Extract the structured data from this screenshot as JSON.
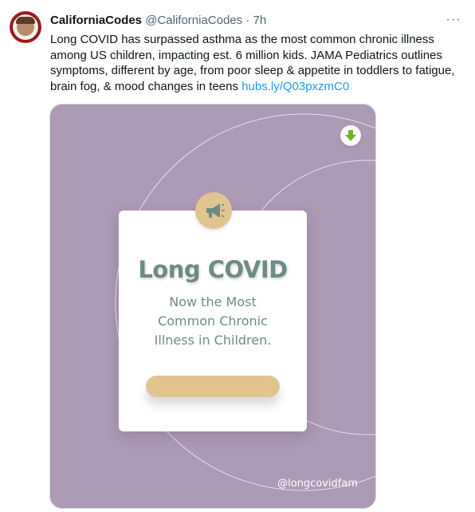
{
  "tweet": {
    "display_name": "CaliforniaCodes",
    "handle": "@CaliforniaCodes",
    "separator": "·",
    "time": "7h",
    "more_label": "···",
    "text_lines": [
      "Long COVID has surpassed asthma as the most common chronic illness",
      "among US children, impacting est. 6 million kids. JAMA Pediatrics outlines",
      "symptoms, different by age, from poor sleep & appetite in toddlers to fatigue,",
      "brain fog, & mood changes in teens"
    ],
    "link": "hubs.ly/Q03pxzmC0"
  },
  "card": {
    "title": "Long COVID",
    "subtitle_lines": [
      "Now the Most",
      "Common Chronic",
      "Illness in Children."
    ],
    "credit": "@longcovidfam",
    "colors": {
      "background": "#ad9ab5",
      "panel": "#ffffff",
      "accent": "#e2c48f",
      "text": "#6e8b86",
      "download_arrow": "#6fb52c"
    },
    "icons": {
      "badge": "megaphone-icon",
      "corner": "download-arrow-icon"
    }
  }
}
